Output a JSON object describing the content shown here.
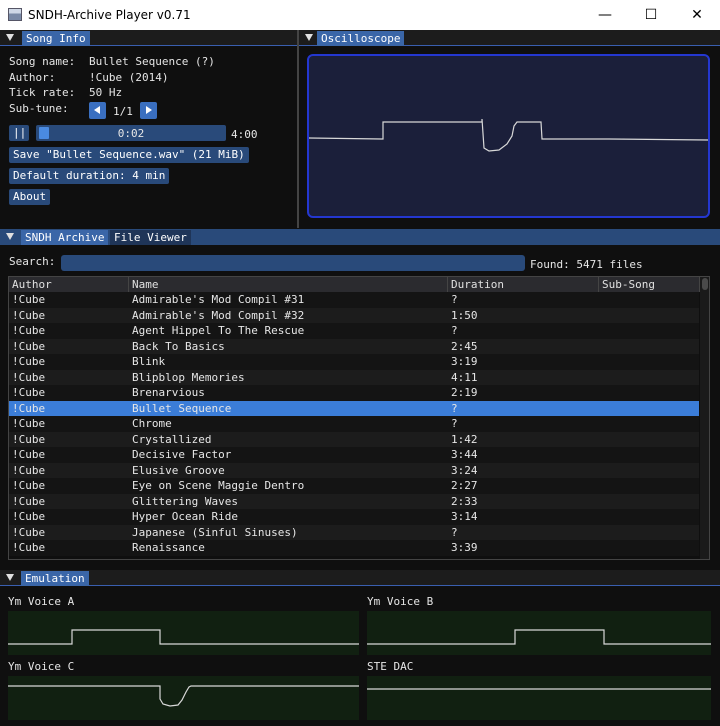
{
  "window": {
    "title": "SNDH-Archive Player v0.71",
    "minimize_glyph": "—",
    "maximize_glyph": "☐",
    "close_glyph": "✕"
  },
  "song_info": {
    "tab": "Song Info",
    "name_label": "Song name:",
    "name_value": "Bullet Sequence (?)",
    "author_label": "Author:",
    "author_value": "!Cube (2014)",
    "tick_label": "Tick rate:",
    "tick_value": "50 Hz",
    "subtune_label": "Sub-tune:",
    "subtune_value": "1/1",
    "pause_label": "||",
    "position": "0:02",
    "position_fraction": 0.0083,
    "total": "4:00",
    "save_label": "Save \"Bullet Sequence.wav\" (21 MiB)",
    "default_duration_label": "Default duration: 4 min",
    "about_label": "About"
  },
  "oscilloscope": {
    "tab": "Oscilloscope"
  },
  "archive": {
    "tabs": [
      "SNDH Archive",
      "File Viewer"
    ],
    "search_label": "Search:",
    "search_value": "",
    "found_label": "Found: 5471 files",
    "columns": [
      "Author",
      "Name",
      "Duration",
      "Sub-Song"
    ],
    "rows": [
      [
        "!Cube",
        "Admirable's Mod Compil #31",
        "?",
        ""
      ],
      [
        "!Cube",
        "Admirable's Mod Compil #32",
        "1:50",
        ""
      ],
      [
        "!Cube",
        "Agent Hippel To The Rescue",
        "?",
        ""
      ],
      [
        "!Cube",
        "Back To Basics",
        "2:45",
        ""
      ],
      [
        "!Cube",
        "Blink",
        "3:19",
        ""
      ],
      [
        "!Cube",
        "Blipblop Memories",
        "4:11",
        ""
      ],
      [
        "!Cube",
        "Brenarvious",
        "2:19",
        ""
      ],
      [
        "!Cube",
        "Bullet Sequence",
        "?",
        ""
      ],
      [
        "!Cube",
        "Chrome",
        "?",
        ""
      ],
      [
        "!Cube",
        "Crystallized",
        "1:42",
        ""
      ],
      [
        "!Cube",
        "Decisive Factor",
        "3:44",
        ""
      ],
      [
        "!Cube",
        "Elusive Groove",
        "3:24",
        ""
      ],
      [
        "!Cube",
        "Eye on Scene Maggie Dentro",
        "2:27",
        ""
      ],
      [
        "!Cube",
        "Glittering Waves",
        "2:33",
        ""
      ],
      [
        "!Cube",
        "Hyper Ocean Ride",
        "3:14",
        ""
      ],
      [
        "!Cube",
        "Japanese (Sinful Sinuses)",
        "?",
        ""
      ],
      [
        "!Cube",
        "Renaissance",
        "3:39",
        ""
      ]
    ],
    "selected_row": 7
  },
  "emulation": {
    "tab": "Emulation",
    "voices": [
      "Ym Voice A",
      "Ym Voice B",
      "Ym Voice C",
      "STE DAC"
    ]
  }
}
